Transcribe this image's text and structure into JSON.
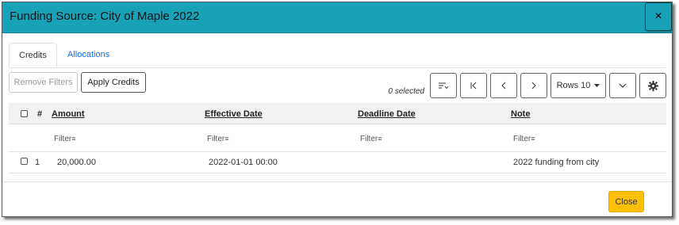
{
  "modal": {
    "title": "Funding Source: City of Maple 2022",
    "close_icon": "×"
  },
  "tabs": [
    {
      "label": "Credits",
      "active": true
    },
    {
      "label": "Allocations",
      "active": false
    }
  ],
  "toolbar": {
    "remove_filters": "Remove Filters",
    "apply_credits": "Apply Credits",
    "selected_text": "0 selected",
    "rows_label": "Rows 10",
    "icons": {
      "sort": "sort-icon",
      "first": "first-page-icon",
      "prev": "previous-page-icon",
      "next": "next-page-icon",
      "rows_caret": "caret-down-icon",
      "expand": "chevron-down-icon",
      "settings": "gear-icon"
    }
  },
  "grid": {
    "columns": [
      "#",
      "Amount",
      "Effective Date",
      "Deadline Date",
      "Note"
    ],
    "filter_label": "Filter",
    "rows": [
      {
        "num": "1",
        "amount": "20,000.00",
        "effective_date": "2022-01-01 00:00",
        "deadline_date": "",
        "note": "2022 funding from city"
      }
    ]
  },
  "footer": {
    "close_label": "Close"
  },
  "colors": {
    "header": "#17a2b8",
    "close_button": "#ffc107",
    "link": "#0d6efd"
  }
}
